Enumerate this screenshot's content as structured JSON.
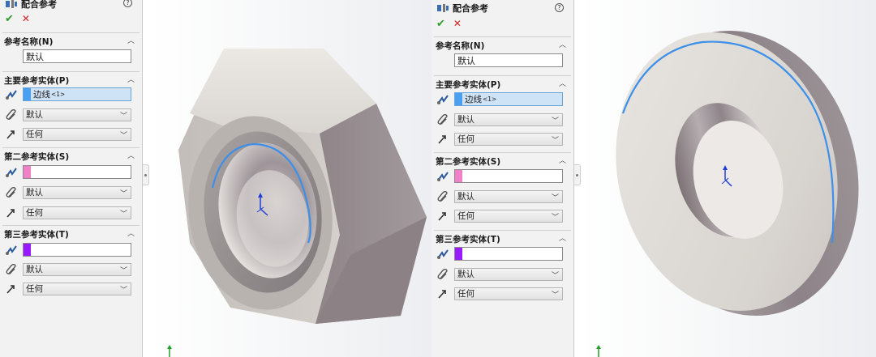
{
  "panes": [
    {
      "title": "配合参考",
      "help_glyph": "?",
      "ok_glyph": "✔",
      "cancel_glyph": "✕",
      "ref_name": {
        "header": "参考名称(N)",
        "value": "默认"
      },
      "primary": {
        "header": "主要参考实体(P)",
        "entity_text": "边线",
        "entity_sub": "<1>",
        "mate_type": "默认",
        "alignment": "任何",
        "color": "#4a9ff0"
      },
      "secondary": {
        "header": "第二参考实体(S)",
        "mate_type": "默认",
        "alignment": "任何",
        "color": "#f080c8"
      },
      "tertiary": {
        "header": "第三参考实体(T)",
        "mate_type": "默认",
        "alignment": "任何",
        "color": "#9a1aff"
      },
      "model": "hex-nut"
    },
    {
      "title": "配合参考",
      "help_glyph": "?",
      "ok_glyph": "✔",
      "cancel_glyph": "✕",
      "ref_name": {
        "header": "参考名称(N)",
        "value": "默认"
      },
      "primary": {
        "header": "主要参考实体(P)",
        "entity_text": "边线",
        "entity_sub": "<1>",
        "mate_type": "默认",
        "alignment": "任何",
        "color": "#4a9ff0"
      },
      "secondary": {
        "header": "第二参考实体(S)",
        "mate_type": "默认",
        "alignment": "任何",
        "color": "#f080c8"
      },
      "tertiary": {
        "header": "第三参考实体(T)",
        "mate_type": "默认",
        "alignment": "任何",
        "color": "#9a1aff"
      },
      "model": "flat-washer"
    }
  ],
  "colors": {
    "selected_edge": "#3d8fe8",
    "triad_blue": "#1f3fd6",
    "triad_green": "#22a22a"
  }
}
